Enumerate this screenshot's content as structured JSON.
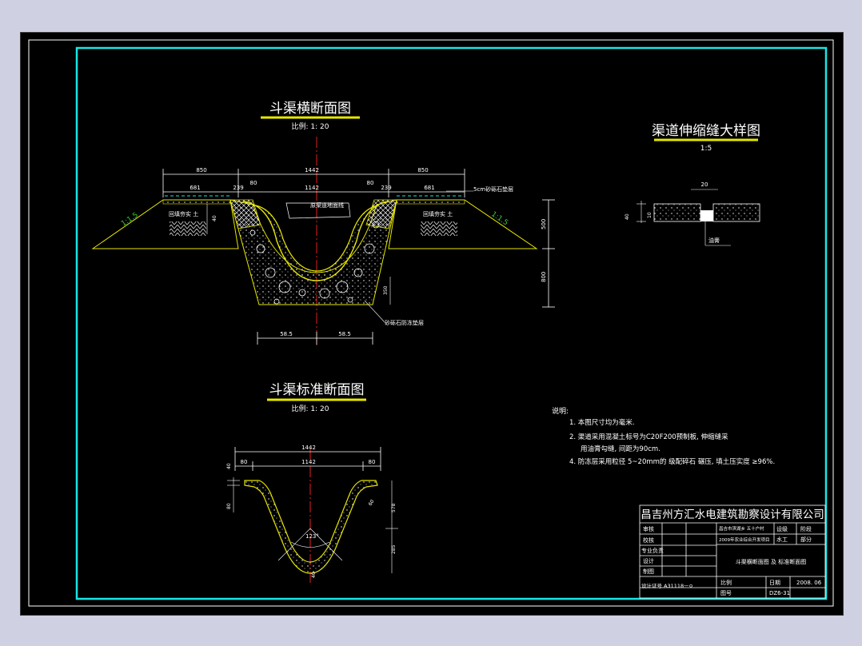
{
  "colors": {
    "frame": "#19e6e6",
    "line": "#ffffff",
    "accent": "#e6e600",
    "axis": "#e02020",
    "green": "#33cc33",
    "dim": "#c8c8c8"
  },
  "cross_section": {
    "title": "斗渠横断面图",
    "scale": "比例: 1: 20",
    "dims_top": [
      "850",
      "1442",
      "850"
    ],
    "dims_second": [
      "681",
      "239",
      "80",
      "1142",
      "80",
      "239",
      "681"
    ],
    "slope_left": "1:1.5",
    "slope_right": "1:1.5",
    "backfill_left": "回填夯实 土",
    "backfill_right": "回填夯实 土",
    "ground_line": "原渠道地面线",
    "cushion_top": "5cm砂砾石垫层",
    "anti_frost": "砂砾石防冻垫层",
    "side_dim_40": "40",
    "right_dims": [
      "500",
      "800"
    ],
    "inner_dim": "350",
    "bottom_dims": [
      "58.5",
      "58.5"
    ]
  },
  "standard_section": {
    "title": "斗渠标准断面图",
    "scale": "比例: 1: 20",
    "dim_total": "1442",
    "dims_second": [
      "80",
      "1142",
      "80"
    ],
    "left_dims": [
      "40",
      "80"
    ],
    "right_dims": [
      "578",
      "285"
    ],
    "angle": "123°",
    "side_label": "60",
    "bottom_label": "40"
  },
  "joint_detail": {
    "title": "渠道伸缩缝大样图",
    "scale": "1:5",
    "dim_width": "20",
    "dim_side": "40",
    "dim_side2": "10",
    "label": "油膏"
  },
  "notes": {
    "heading": "说明:",
    "items": [
      "1. 本图尺寸均为毫米.",
      "2. 渠道采用混凝土标号为C20F200预制板, 伸缩缝采",
      "用油膏勾缝, 间距为90cm.",
      "4. 防冻层采用粒径 5~20mm的 级配碎石 碾压, 填土压实度 ≥96%."
    ]
  },
  "title_block": {
    "company": "昌吉州方汇水电建筑勘察设计有限公司",
    "roles": [
      "审核",
      "校核",
      "专业负责",
      "设计",
      "制图"
    ],
    "project_line1": "昌吉市滨湖乡 五十户村",
    "project_line2": "2009年农业综合开发项目",
    "stage_label": "设级",
    "stage_value": "阶段",
    "discipline_label": "水工",
    "discipline_value": "部分",
    "drawing_name": "斗渠横断面图 及 标准断面图",
    "cert": "设计证号 A31118ㅡㅇ",
    "scale_label": "比例",
    "date_label": "日期",
    "date_value": "2008. 06",
    "drawing_no_label": "图号",
    "drawing_no": "DZ6-31"
  }
}
